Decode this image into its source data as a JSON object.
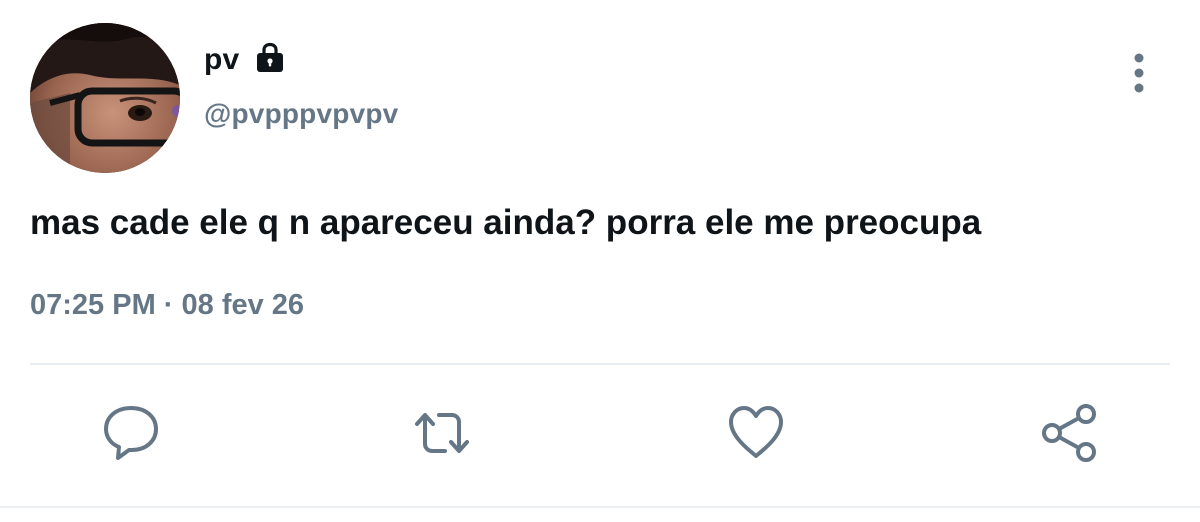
{
  "user": {
    "display_name": "pv",
    "handle": "@pvpppvpvpv",
    "avatar_icon": "profile-photo",
    "protected_icon": "lock-icon"
  },
  "tweet": {
    "text": "mas cade ele q n apareceu ainda? porra ele me preocupa",
    "timestamp": "07:25 PM · 08 fev 26"
  },
  "actions": [
    {
      "name": "reply",
      "icon": "reply-icon"
    },
    {
      "name": "retweet",
      "icon": "retweet-icon"
    },
    {
      "name": "like",
      "icon": "heart-icon"
    },
    {
      "name": "share",
      "icon": "share-icon"
    }
  ],
  "menu_icon": "more-vertical-icon",
  "colors": {
    "text_primary": "#0f1419",
    "text_secondary": "#657786",
    "icon": "#657786",
    "divider": "#e6ecf0"
  }
}
